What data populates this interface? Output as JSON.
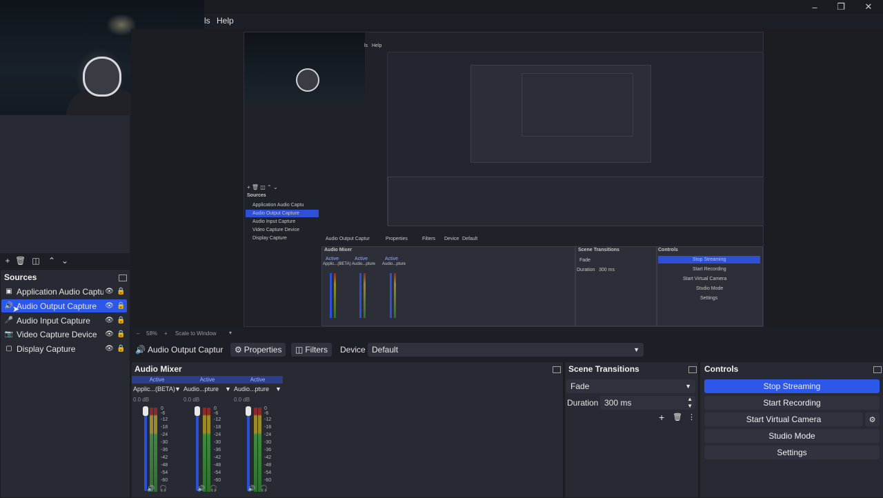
{
  "window": {
    "buttons": [
      "minimize-icon",
      "restore-icon",
      "close-icon"
    ]
  },
  "menu": {
    "partial_tools": "ls",
    "help": "Help"
  },
  "preview": {
    "zoom": "58%",
    "scale_mode": "Scale to Window",
    "nested": {
      "menu_partial": "ls",
      "menu_help": "Help",
      "sources_title": "Sources",
      "sources": [
        "Application Audio Captu",
        "Audio Output Capture",
        "Audio Input Capture",
        "Video Capture Device",
        "Display Capture"
      ],
      "context_source": "Audio Output Captur",
      "properties": "Properties",
      "filters": "Filters",
      "device_label": "Device",
      "device_value": "Default",
      "mixer_title": "Audio Mixer",
      "mixer_channels": [
        {
          "status": "Active",
          "name": "Applic...(BETA)"
        },
        {
          "status": "Active",
          "name": "Audio...pture"
        },
        {
          "status": "Active",
          "name": "Audio...pture"
        }
      ],
      "transitions_title": "Scene Transitions",
      "transition": "Fade",
      "duration_label": "Duration",
      "duration": "300 ms",
      "controls_title": "Controls",
      "controls": [
        "Stop Streaming",
        "Start Recording",
        "Start Virtual Camera",
        "Studio Mode",
        "Settings"
      ]
    }
  },
  "sources": {
    "title": "Sources",
    "items": [
      {
        "label": "Application Audio Captu",
        "icon": "app-audio-icon",
        "selected": false
      },
      {
        "label": "Audio Output Capture",
        "icon": "speaker-icon",
        "selected": true
      },
      {
        "label": "Audio Input Capture",
        "icon": "microphone-icon",
        "selected": false
      },
      {
        "label": "Video Capture Device",
        "icon": "camera-icon",
        "selected": false
      },
      {
        "label": "Display Capture",
        "icon": "display-icon",
        "selected": false
      }
    ]
  },
  "context_bar": {
    "source": "Audio Output Captur",
    "properties": "Properties",
    "filters": "Filters",
    "device_label": "Device",
    "device_value": "Default"
  },
  "mixer": {
    "title": "Audio Mixer",
    "channels": [
      {
        "status": "Active",
        "name": "Applic...(BETA)",
        "db": "0.0 dB"
      },
      {
        "status": "Active",
        "name": "Audio...pture",
        "db": "0.0 dB"
      },
      {
        "status": "Active",
        "name": "Audio...pture",
        "db": "0.0 dB"
      }
    ],
    "scale": [
      "0",
      "-6",
      "-12",
      "-18",
      "-24",
      "-30",
      "-36",
      "-42",
      "-48",
      "-54",
      "-60"
    ]
  },
  "transitions": {
    "title": "Scene Transitions",
    "type": "Fade",
    "duration_label": "Duration",
    "duration": "300 ms"
  },
  "controls": {
    "title": "Controls",
    "stop_streaming": "Stop Streaming",
    "start_recording": "Start Recording",
    "start_virtual_camera": "Start Virtual Camera",
    "studio_mode": "Studio Mode",
    "settings": "Settings"
  },
  "colors": {
    "accent": "#2d57e8",
    "panel": "#272a33",
    "background": "#1d1f26"
  }
}
